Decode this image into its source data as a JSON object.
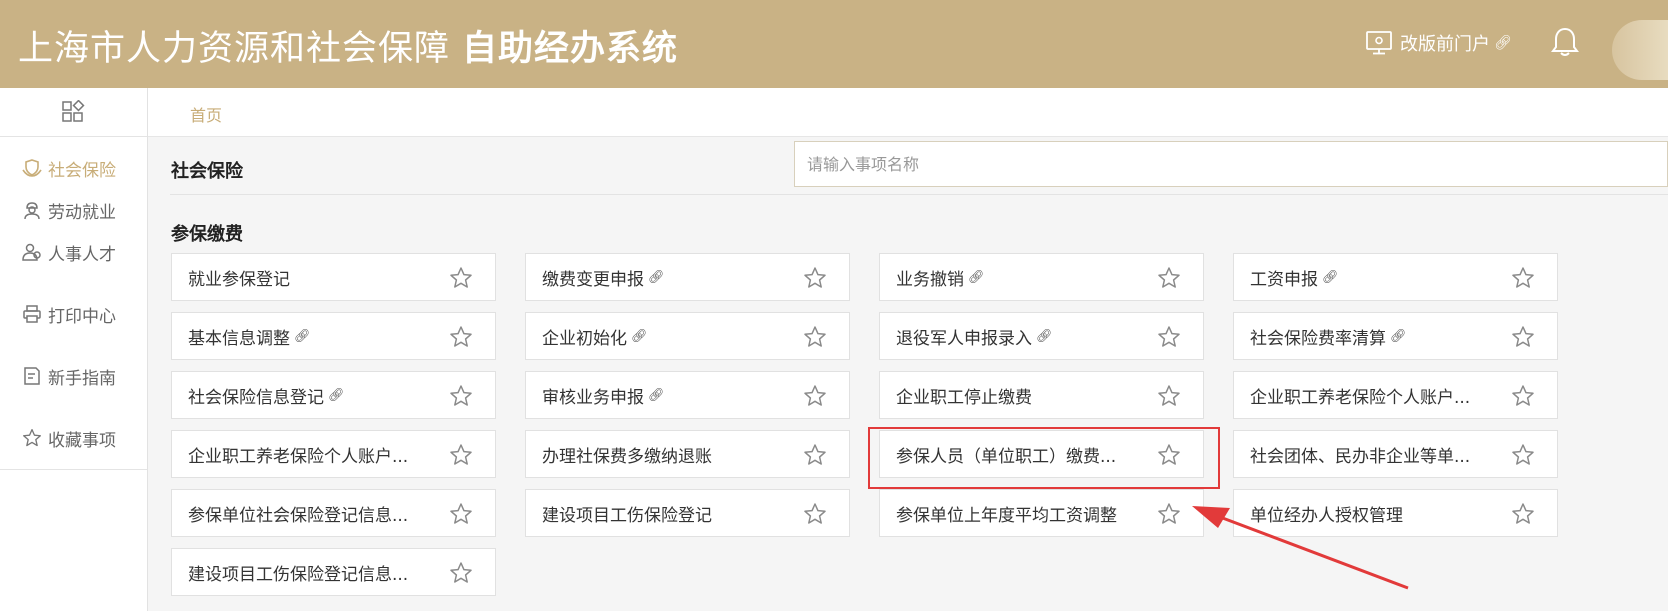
{
  "header": {
    "title_regular": "上海市人力资源和社会保障",
    "title_bold": "自助经办系统",
    "portal_link_label": "改版前门户"
  },
  "sidebar": {
    "items": [
      {
        "label": "社会保险",
        "icon": "shield-hand-icon",
        "active": true
      },
      {
        "label": "劳动就业",
        "icon": "worker-icon"
      },
      {
        "label": "人事人才",
        "icon": "people-icon"
      },
      {
        "label": "打印中心",
        "icon": "printer-icon"
      },
      {
        "label": "新手指南",
        "icon": "guide-icon"
      },
      {
        "label": "收藏事项",
        "icon": "star-icon"
      }
    ]
  },
  "breadcrumb": "首页",
  "main": {
    "section_title": "社会保险",
    "search_placeholder": "请输入事项名称",
    "group_title": "参保缴费",
    "items": [
      {
        "label": "就业参保登记",
        "link": false
      },
      {
        "label": "缴费变更申报",
        "link": true
      },
      {
        "label": "业务撤销",
        "link": true
      },
      {
        "label": "工资申报",
        "link": true
      },
      {
        "label": "基本信息调整",
        "link": true
      },
      {
        "label": "企业初始化",
        "link": true
      },
      {
        "label": "退役军人申报录入",
        "link": true
      },
      {
        "label": "社会保险费率清算",
        "link": true
      },
      {
        "label": "社会保险信息登记",
        "link": true
      },
      {
        "label": "审核业务申报",
        "link": true
      },
      {
        "label": "企业职工停止缴费",
        "link": false
      },
      {
        "label": "企业职工养老保险个人账户...",
        "link": false
      },
      {
        "label": "企业职工养老保险个人账户...",
        "link": false
      },
      {
        "label": "办理社保费多缴纳退账",
        "link": false
      },
      {
        "label": "参保人员（单位职工）缴费...",
        "link": false
      },
      {
        "label": "社会团体、民办非企业等单...",
        "link": false
      },
      {
        "label": "参保单位社会保险登记信息...",
        "link": false
      },
      {
        "label": "建设项目工伤保险登记",
        "link": false
      },
      {
        "label": "参保单位上年度平均工资调整",
        "link": false
      },
      {
        "label": "单位经办人授权管理",
        "link": false
      },
      {
        "label": "建设项目工伤保险登记信息...",
        "link": false
      }
    ]
  },
  "colors": {
    "header_bg": "#c9b285",
    "accent": "#c8ad78",
    "highlight": "#e23a3a"
  }
}
